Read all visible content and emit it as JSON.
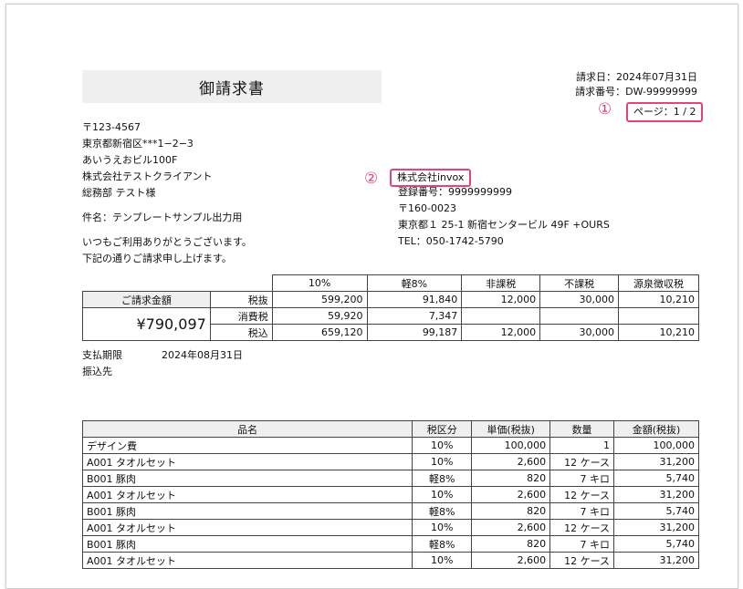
{
  "title": "御請求書",
  "invoice_meta": {
    "date": "請求日：2024年07月31日",
    "number": "請求番号：DW-99999999",
    "page": "ページ：1 / 2",
    "marker1": "①"
  },
  "client": {
    "postal": "〒123-4567",
    "address1": "東京都新宿区***1−2−3",
    "address2": "あいうえおビル100F",
    "company": "株式会社テストクライアント",
    "contact": "総務部 テスト様",
    "subject": "件名：テンプレートサンプル出力用",
    "greeting1": "いつもご利用ありがとうございます。",
    "greeting2": "下記の通りご請求申し上げます。"
  },
  "issuer": {
    "marker2": "②",
    "company": "株式会社invox",
    "registration": "登録番号：9999999999",
    "postal": "〒160-0023",
    "address": "東京都１ 25-1 新宿センタービル 49F +OURS",
    "tel": "TEL：050-1742-5790"
  },
  "summary": {
    "total_label": "ご請求金額",
    "total_value": "¥790,097",
    "columns": [
      "10%",
      "軽8%",
      "非課税",
      "不課税",
      "源泉徴収税"
    ],
    "rows": [
      {
        "label": "税抜",
        "values": [
          "599,200",
          "91,840",
          "12,000",
          "30,000",
          "10,210"
        ]
      },
      {
        "label": "消費税",
        "values": [
          "59,920",
          "7,347",
          "",
          "",
          ""
        ]
      },
      {
        "label": "税込",
        "values": [
          "659,120",
          "99,187",
          "12,000",
          "30,000",
          "10,210"
        ]
      }
    ]
  },
  "payment": {
    "due_label": "支払期限",
    "due_value": "2024年08月31日",
    "bank_label": "振込先"
  },
  "items": {
    "headers": [
      "品名",
      "税区分",
      "単価(税抜)",
      "数量",
      "金額(税抜)"
    ],
    "rows": [
      [
        "デザイン費",
        "10%",
        "100,000",
        "1",
        "100,000"
      ],
      [
        "A001 タオルセット",
        "10%",
        "2,600",
        "12 ケース",
        "31,200"
      ],
      [
        "B001 豚肉",
        "軽8%",
        "820",
        "7 キロ",
        "5,740"
      ],
      [
        "A001 タオルセット",
        "10%",
        "2,600",
        "12 ケース",
        "31,200"
      ],
      [
        "B001 豚肉",
        "軽8%",
        "820",
        "7 キロ",
        "5,740"
      ],
      [
        "A001 タオルセット",
        "10%",
        "2,600",
        "12 ケース",
        "31,200"
      ],
      [
        "B001 豚肉",
        "軽8%",
        "820",
        "7 キロ",
        "5,740"
      ],
      [
        "A001 タオルセット",
        "10%",
        "2,600",
        "12 ケース",
        "31,200"
      ]
    ]
  }
}
